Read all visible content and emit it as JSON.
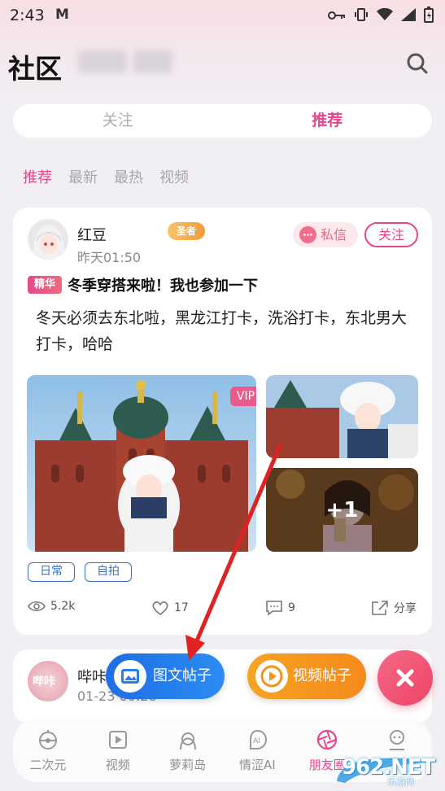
{
  "status_bar": {
    "time": "2:43",
    "mail_icon": "M"
  },
  "header": {
    "title": "社区"
  },
  "top_tabs": [
    {
      "label": "关注"
    },
    {
      "label": "推荐"
    }
  ],
  "sub_tabs": [
    {
      "label": "推荐"
    },
    {
      "label": "最新"
    },
    {
      "label": "最热"
    },
    {
      "label": "视频"
    }
  ],
  "post": {
    "user_name": "红豆",
    "medal": "圣者",
    "time": "昨天01:50",
    "dm_label": "私信",
    "follow_label": "关注",
    "badge": "精华",
    "title": "冬季穿搭来啦！我也参加一下",
    "body": "冬天必须去东北啦，黑龙江打卡，洗浴打卡，东北男大打卡，哈哈",
    "vip_label": "VIP",
    "more_count": "+1",
    "tags": [
      "日常",
      "自拍"
    ],
    "views": "5.2k",
    "likes": "17",
    "comments": "9",
    "share_label": "分享"
  },
  "post2": {
    "user_name": "哔咔",
    "time": "01-23 00:28"
  },
  "fab": {
    "text_post": "图文帖子",
    "video_post": "视频帖子"
  },
  "bottom_nav": [
    {
      "label": "二次元",
      "icon": "alien-icon"
    },
    {
      "label": "视频",
      "icon": "play-icon"
    },
    {
      "label": "萝莉岛",
      "icon": "girl-icon"
    },
    {
      "label": "情涩AI",
      "icon": "ai-icon"
    },
    {
      "label": "朋友圈",
      "icon": "aperture-icon"
    },
    {
      "label": "",
      "icon": "profile-icon"
    }
  ],
  "watermark": {
    "brand": "962.NET",
    "sub": "乐游网"
  },
  "colors": {
    "accent": "#e9458b",
    "blue": "#1e6de6",
    "orange": "#f6a323",
    "red_close": "#ee4468"
  }
}
